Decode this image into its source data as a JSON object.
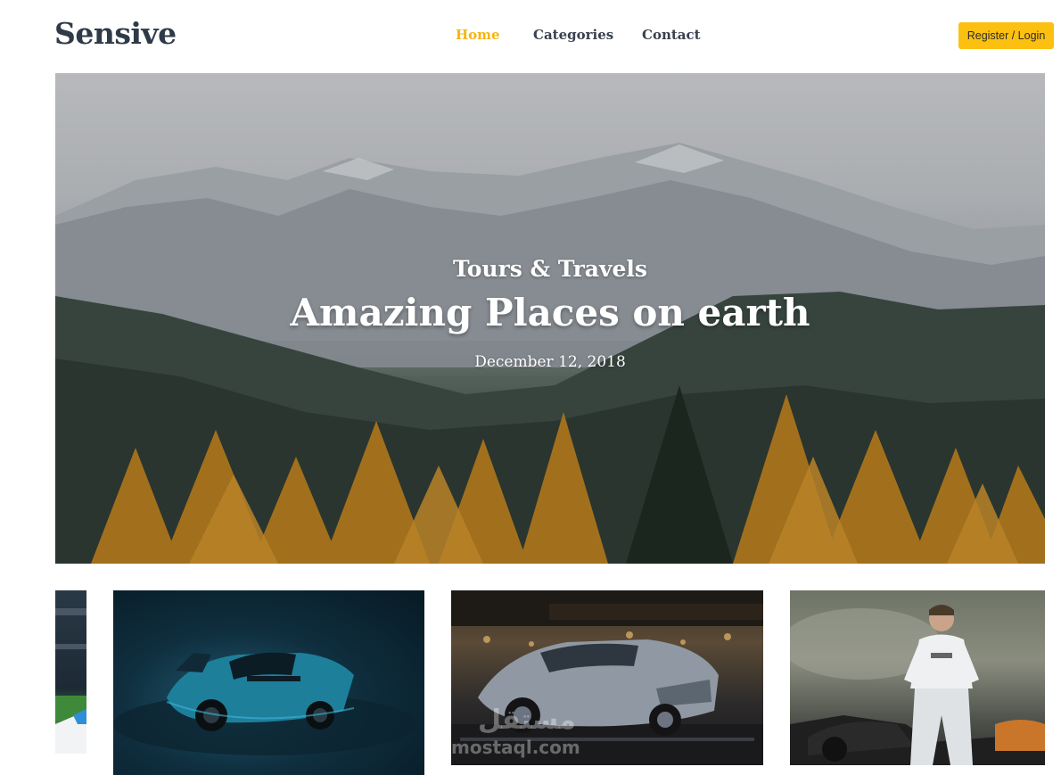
{
  "header": {
    "logo": "Sensive",
    "nav": [
      {
        "label": "Home",
        "active": true
      },
      {
        "label": "Categories",
        "active": false
      },
      {
        "label": "Contact",
        "active": false
      }
    ],
    "login_label": "Register / Login"
  },
  "hero": {
    "category": "Tours & Travels",
    "title": "Amazing Places on earth",
    "date": "December 12, 2018"
  },
  "watermark": {
    "arabic": "مستقل",
    "latin": "mostaql.com"
  },
  "colors": {
    "accent": "#f5b50c",
    "button": "#fcc010",
    "logo": "#2f3a49"
  }
}
